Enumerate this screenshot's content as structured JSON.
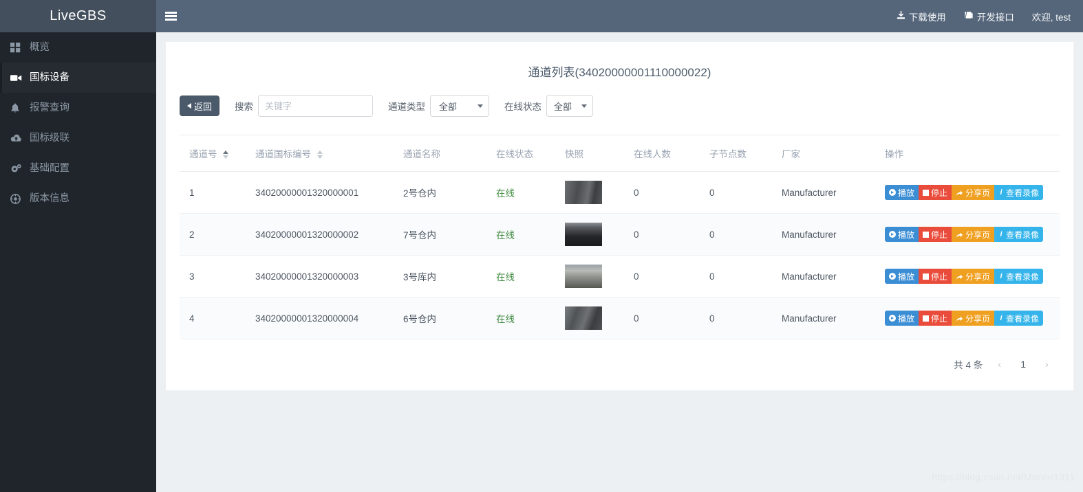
{
  "brand": {
    "name": "LiveGBS"
  },
  "sidebar": {
    "items": [
      {
        "label": "概览",
        "icon": "grid-icon",
        "active": false
      },
      {
        "label": "国标设备",
        "icon": "video-camera-icon",
        "active": true
      },
      {
        "label": "报警查询",
        "icon": "bell-icon",
        "active": false
      },
      {
        "label": "国标级联",
        "icon": "cloud-upload-icon",
        "active": false
      },
      {
        "label": "基础配置",
        "icon": "gears-icon",
        "active": false
      },
      {
        "label": "版本信息",
        "icon": "info-globe-icon",
        "active": false
      }
    ]
  },
  "topbar": {
    "menu_toggle": "hamburger-icon",
    "links": [
      {
        "label": "下载使用",
        "icon": "download-icon"
      },
      {
        "label": "开发接口",
        "icon": "book-icon"
      }
    ],
    "user_greeting": "欢迎, test"
  },
  "page": {
    "title": "通道列表(34020000001110000022)"
  },
  "toolbar": {
    "back_label": "返回",
    "search_label": "搜索",
    "search_value": "",
    "search_placeholder": "关键字",
    "channel_type_label": "通道类型",
    "channel_type_value": "全部",
    "online_state_label": "在线状态",
    "online_state_value": "全部"
  },
  "table": {
    "headers": [
      {
        "label": "通道号",
        "sortable": true,
        "sort": "asc"
      },
      {
        "label": "通道国标编号",
        "sortable": true,
        "sort": "none"
      },
      {
        "label": "通道名称",
        "sortable": false
      },
      {
        "label": "在线状态",
        "sortable": false
      },
      {
        "label": "快照",
        "sortable": false
      },
      {
        "label": "在线人数",
        "sortable": false
      },
      {
        "label": "子节点数",
        "sortable": false
      },
      {
        "label": "厂家",
        "sortable": false
      },
      {
        "label": "操作",
        "sortable": false
      }
    ],
    "rows": [
      {
        "no": "1",
        "gb_id": "34020000001320000001",
        "name": "2号仓内",
        "status": "在线",
        "snapshot": "camera-thumbnail",
        "online_count": "0",
        "child_count": "0",
        "manufacturer": "Manufacturer"
      },
      {
        "no": "2",
        "gb_id": "34020000001320000002",
        "name": "7号仓内",
        "status": "在线",
        "snapshot": "camera-thumbnail",
        "online_count": "0",
        "child_count": "0",
        "manufacturer": "Manufacturer"
      },
      {
        "no": "3",
        "gb_id": "34020000001320000003",
        "name": "3号库内",
        "status": "在线",
        "snapshot": "camera-thumbnail",
        "online_count": "0",
        "child_count": "0",
        "manufacturer": "Manufacturer"
      },
      {
        "no": "4",
        "gb_id": "34020000001320000004",
        "name": "6号仓内",
        "status": "在线",
        "snapshot": "camera-thumbnail",
        "online_count": "0",
        "child_count": "0",
        "manufacturer": "Manufacturer"
      }
    ],
    "actions": [
      {
        "label": "播放",
        "icon": "play-icon",
        "color": "#3b8dd4"
      },
      {
        "label": "停止",
        "icon": "stop-icon",
        "color": "#ea4c3b"
      },
      {
        "label": "分享页",
        "icon": "share-icon",
        "color": "#f0a021"
      },
      {
        "label": "查看录像",
        "icon": "info-icon",
        "color": "#34b4ea"
      }
    ]
  },
  "pagination": {
    "total_text": "共 4 条",
    "prev": "‹",
    "current_page": "1",
    "next": "›"
  },
  "watermark": {
    "text": "https://blog.csdn.net/Marvin1311"
  }
}
